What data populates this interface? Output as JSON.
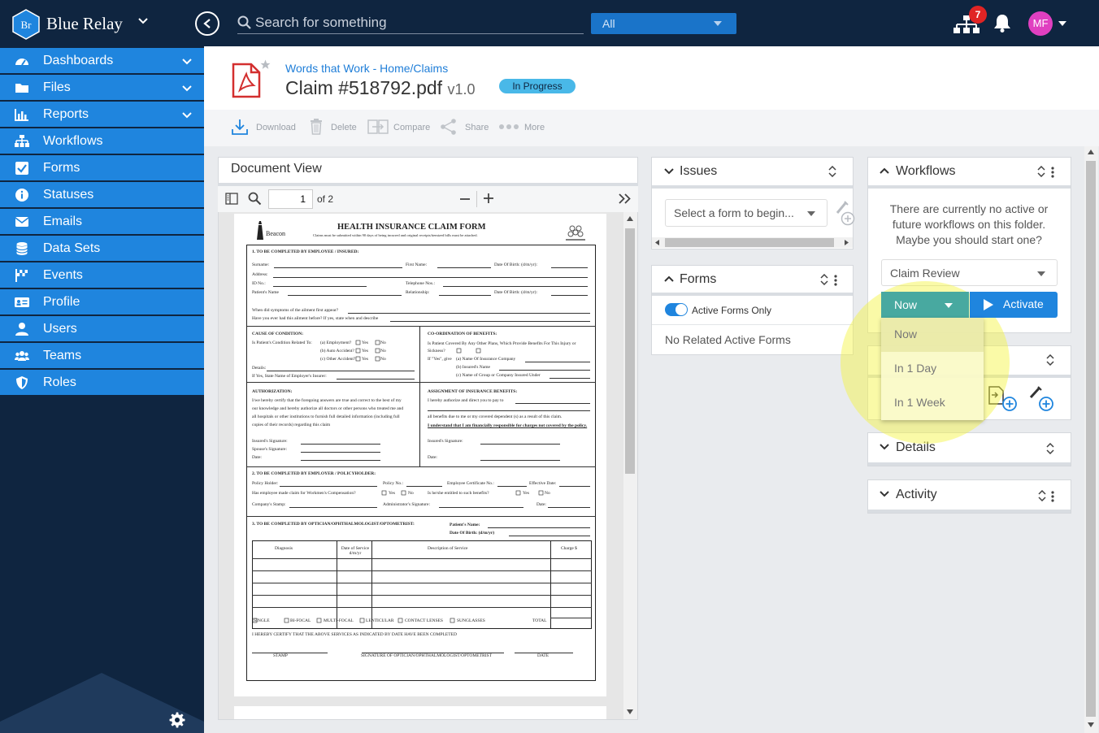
{
  "app": {
    "brand": "Blue Relay",
    "logo_text": "Br",
    "search_placeholder": "Search for something",
    "search_scope": "All",
    "notification_count": "7",
    "user_initials": "MF"
  },
  "sidebar": {
    "items": [
      {
        "label": "Dashboards",
        "icon": "dashboard-icon",
        "expandable": true
      },
      {
        "label": "Files",
        "icon": "folder-icon",
        "expandable": true
      },
      {
        "label": "Reports",
        "icon": "bar-chart-icon",
        "expandable": true
      },
      {
        "label": "Workflows",
        "icon": "sitemap-icon",
        "expandable": false
      },
      {
        "label": "Forms",
        "icon": "checkbox-icon",
        "expandable": false
      },
      {
        "label": "Statuses",
        "icon": "info-icon",
        "expandable": false
      },
      {
        "label": "Emails",
        "icon": "envelope-icon",
        "expandable": false
      },
      {
        "label": "Data Sets",
        "icon": "database-icon",
        "expandable": false
      },
      {
        "label": "Events",
        "icon": "flag-icon",
        "expandable": false
      },
      {
        "label": "Profile",
        "icon": "id-card-icon",
        "expandable": false
      },
      {
        "label": "Users",
        "icon": "user-icon",
        "expandable": false
      },
      {
        "label": "Teams",
        "icon": "users-icon",
        "expandable": false
      },
      {
        "label": "Roles",
        "icon": "shield-icon",
        "expandable": false
      }
    ]
  },
  "header": {
    "breadcrumb": "Words that Work - Home/Claims",
    "title": "Claim #518792.pdf",
    "version": "v1.0",
    "status": "In Progress"
  },
  "toolbar": {
    "download": "Download",
    "delete": "Delete",
    "compare": "Compare",
    "share": "Share",
    "more": "More"
  },
  "document": {
    "panel_title": "Document View",
    "current_page": "1",
    "page_total": "of 2",
    "form": {
      "title": "HEALTH INSURANCE CLAIM FORM",
      "subtitle": "Claims must be submitted within 90 days of being incurred and original receipts/itemized bills must be attached.",
      "brand": "Beacon",
      "s1": "1.     TO BE COMPLETED BY EMPLOYEE / INSURED:",
      "surname": "Surname:",
      "first_name": "First Name:",
      "dob": "Date Of Birth: (d/m/yr):",
      "address": "Address:",
      "id_no": "ID No.:",
      "telephone": "Telephone Nos.:",
      "patient_name": "Patient's Name",
      "relationship": "Relationship:",
      "symptoms": "When did symptoms of the ailment first appear?",
      "ever_had": "Have you ever had this ailment before? If yes, state when and describe",
      "cause": "CAUSE OF CONDITION:",
      "cause_q": "Is Patient's Condition Related To:",
      "employment": "(a)  Employment?",
      "auto": "(b)  Auto Accident?",
      "other_accident": "(c)  Other Accident?",
      "yes": "Yes",
      "no": "No",
      "details": "Details:",
      "employer_insurer": "If Yes, State Name of Employer's Insurer:",
      "coord": "CO-ORDINATION OF BENEFITS:",
      "coord_q": "Is Patient Covered By Any Other Plans, Which Provide Benefits For This Injury or Sickness?",
      "if_yes": "If \"Yes\", give",
      "ins_company": "(a)  Name Of Insurance Company",
      "insured_name": "(b)  Insured's Name",
      "group_name": "(c)  Name of Group or Company Insured Under",
      "authorization": "AUTHORIZATION:",
      "auth_text_1": "I/we hereby certify that the foregoing answers are true and correct to the best of my",
      "auth_text_2": "our knowledge and hereby authorize all doctors or other persons who treated me and",
      "auth_text_3": "all hospitals or other institutions to furnish full detailed information (including full",
      "auth_text_4": "copies of their records) regarding this claim",
      "insured_sig": "Insured's Signature:",
      "spouse_sig": "Spouse's Signature:",
      "date": "Date:",
      "assignment": "ASSIGNMENT OF INSURANCE BENEFITS:",
      "assign_1": "I hereby authorize and direct you to pay to",
      "assign_2": "all benefits due to me or my covered dependent (s) as a result of this claim.",
      "assign_3": "I understand that I am financially responsible for charges not covered by the policy.",
      "s2": "2.  TO BE COMPLETED BY EMPLOYER / POLICYHOLDER:",
      "policy_holder": "Policy Holder:",
      "policy_no": "Policy No.:",
      "emp_cert": "Employee Certificate No.:",
      "effective_date": "Effective Date:",
      "workmans": "Has employee made claim for Workmen's Compensation?",
      "entitled": "Is he/she entitled to such benefits?",
      "company_stamp": "Company's Stamp:",
      "admin_sig": "Administrator's Signature:",
      "s3": "3.  TO BE COMPLETED BY OPTICIAN/OPHTHALMOLOGIST/OPTOMETRIST:",
      "patient_name_2": "Patient's Name:",
      "dob_2": "Date Of Birth: (d/m/yr)",
      "col_diagnosis": "Diagnosis",
      "col_date": "Date of Service d/m/yr",
      "col_desc": "Description of Service",
      "col_charge": "Charge $",
      "lens_single": "SINGLE",
      "lens_bifocal": "BI-FOCAL",
      "lens_multifocal": "MULTI-FOCAL",
      "lens_lenticular": "LENTICULAR",
      "lens_contact": "CONTACT LENSES",
      "lens_sunglasses": "SUNGLASSES",
      "total": "TOTAL",
      "certify": "I HEREBY CERTIFY THAT THE ABOVE SERVICES AS INDICATED BY DATE HAVE BEEN COMPLETED",
      "stamp": "STAMP",
      "optician_sig": "SIGNATURE OF OPTICIAN/OPHTHALMOLOGIST/OPTOMETRIST",
      "date_caps": "DATE"
    }
  },
  "issues": {
    "title": "Issues",
    "select_placeholder": "Select a form to begin..."
  },
  "forms": {
    "title": "Forms",
    "toggle_label": "Active Forms Only",
    "toggle_on": true,
    "empty_text": "No Related Active Forms"
  },
  "workflows": {
    "title": "Workflows",
    "message": "There are currently no active or future workflows on this folder. Maybe you should start one?",
    "selected_workflow": "Claim Review",
    "timing": "Now",
    "activate": "Activate",
    "timing_options": [
      "Now",
      "In 1 Day",
      "In 1 Week"
    ]
  },
  "details": {
    "title": "Details"
  },
  "activity": {
    "title": "Activity"
  },
  "colors": {
    "topbar": "#0f2540",
    "nav_item": "#1f85de",
    "accent": "#1f85de",
    "status_badge": "#49b8e8",
    "now_button": "#48a9a0",
    "highlight": "#f5f53c"
  }
}
